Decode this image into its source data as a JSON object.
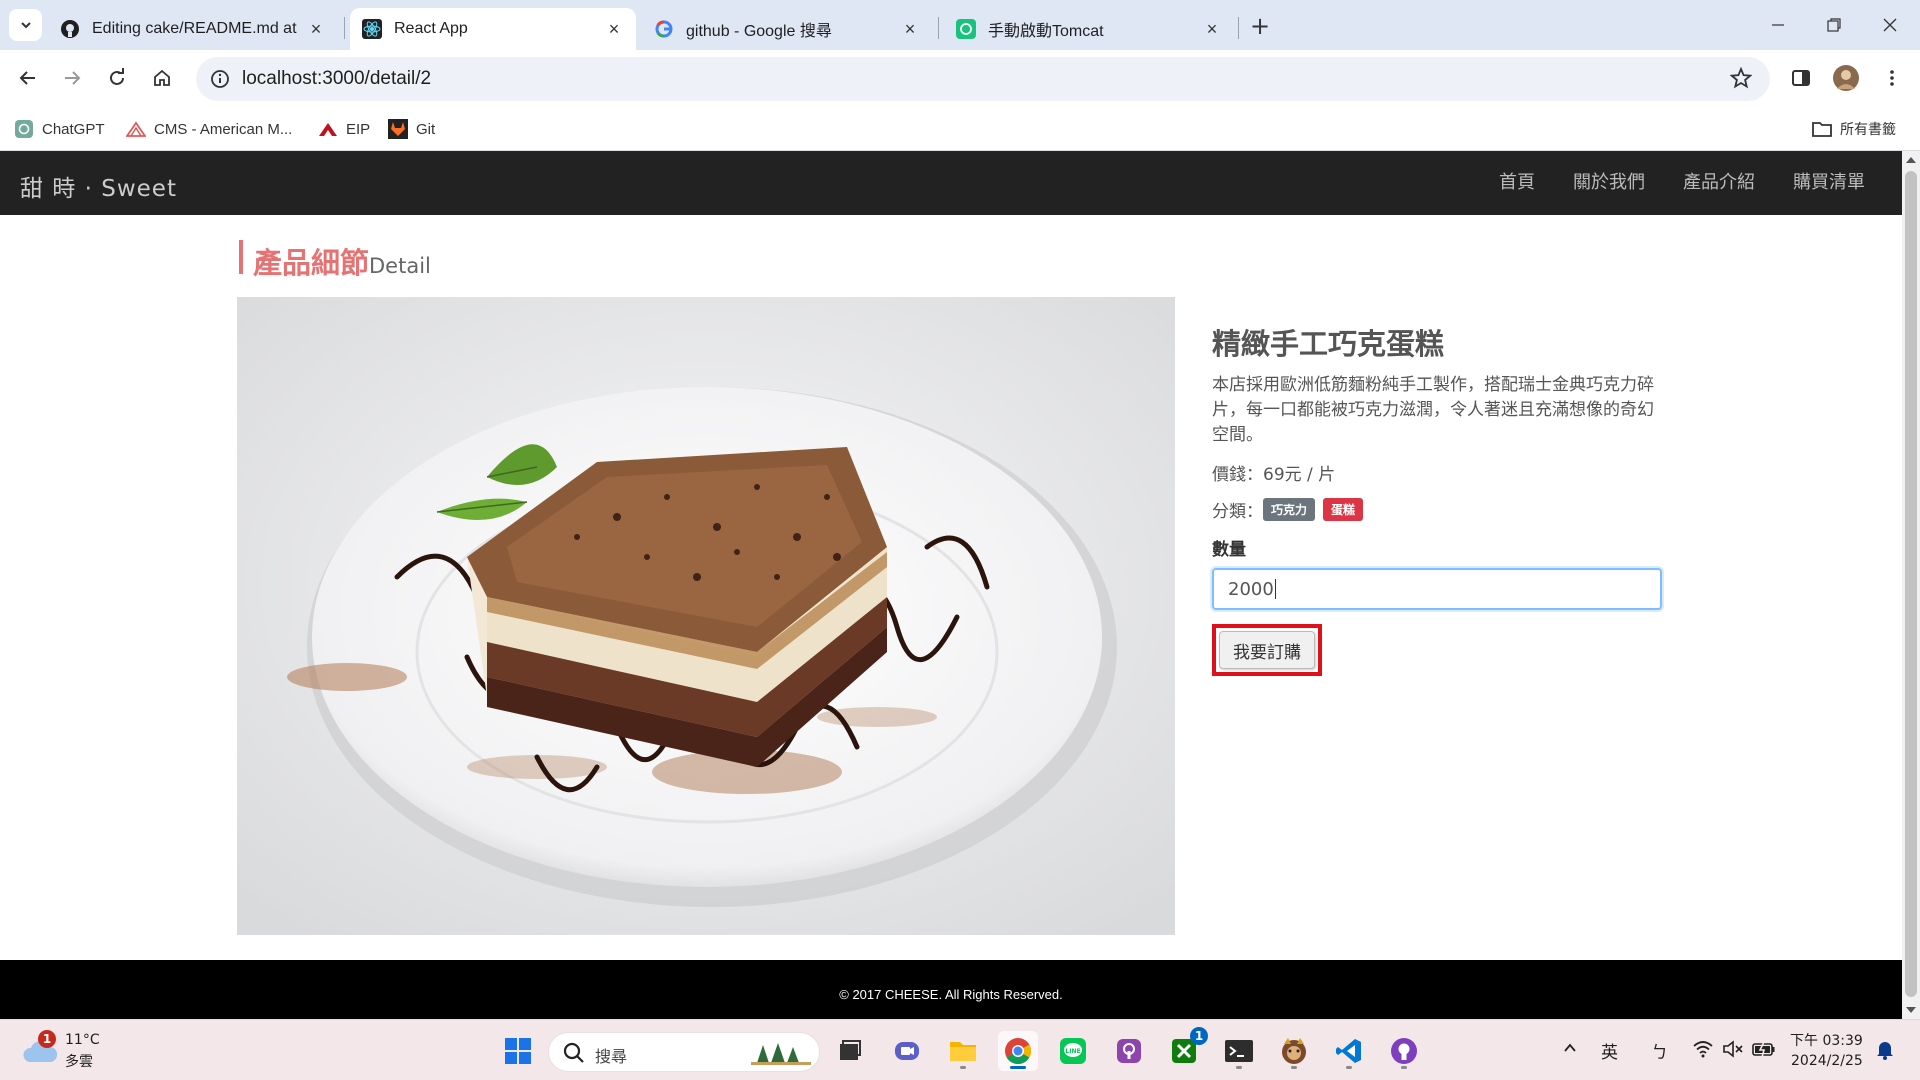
{
  "browser": {
    "tabs": [
      {
        "title": "Editing cake/README.md at main",
        "active": false
      },
      {
        "title": "React App",
        "active": true
      },
      {
        "title": "github - Google 搜尋",
        "active": false
      },
      {
        "title": "手動啟動Tomcat",
        "active": false
      }
    ],
    "url": "localhost:3000/detail/2",
    "bookmarks": [
      "ChatGPT",
      "CMS - American M...",
      "EIP",
      "Git"
    ],
    "bookmarks_folder": "所有書籤"
  },
  "site": {
    "brand": "甜 時 · Sweet",
    "nav": [
      "首頁",
      "關於我們",
      "產品介紹",
      "購買清單"
    ]
  },
  "section": {
    "title_zh": "產品細節",
    "title_en": "Detail"
  },
  "product": {
    "name": "精緻手工巧克蛋糕",
    "description": "本店採用歐洲低筋麵粉純手工製作，搭配瑞士金典巧克力碎片，每一口都能被巧克力滋潤，令人著迷且充滿想像的奇幻空間。",
    "price": "價錢：69元 / 片",
    "category_label": "分類：",
    "categories": [
      {
        "label": "巧克力",
        "color": "#6c757d"
      },
      {
        "label": "蛋糕",
        "color": "#dc3545"
      }
    ],
    "quantity_label": "數量",
    "quantity_value": "2000",
    "order_button": "我要訂購"
  },
  "footer": "© 2017 CHEESE. All Rights Reserved.",
  "taskbar": {
    "weather_temp": "11°C",
    "weather_desc": "多雲",
    "weather_badge": "1",
    "search_placeholder": "搜尋",
    "xbox_badge": "1",
    "ime_lang": "英",
    "ime_mode": "ㄅ",
    "time": "下午 03:39",
    "date": "2024/2/25"
  },
  "colors": {
    "accent": "#e57373",
    "navbar": "#222222",
    "highlight_frame": "#e0101a"
  }
}
